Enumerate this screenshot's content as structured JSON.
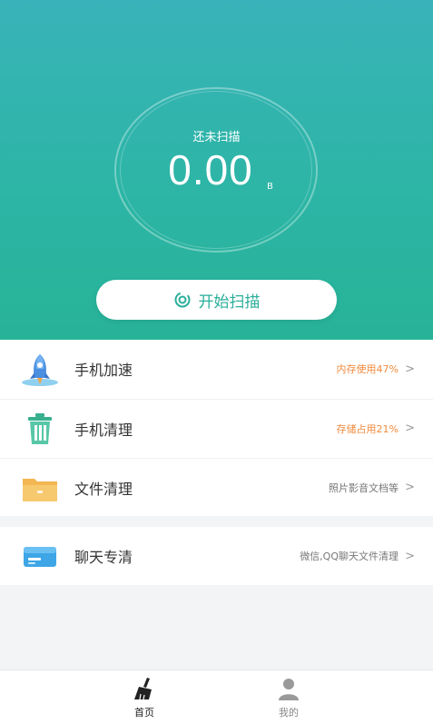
{
  "hero": {
    "status": "还未扫描",
    "value": "0.00",
    "unit": "B",
    "scan_button": "开始扫描"
  },
  "features": [
    {
      "title": "手机加速",
      "subtitle": "内存使用47%",
      "icon": "rocket-icon"
    },
    {
      "title": "手机清理",
      "subtitle": "存储占用21%",
      "icon": "trash-icon"
    },
    {
      "title": "文件清理",
      "subtitle": "照片影音文档等",
      "icon": "folder-icon"
    }
  ],
  "chat_clean": {
    "title": "聊天专清",
    "subtitle": "微信,QQ聊天文件清理",
    "icon": "chat-card-icon"
  },
  "tabs": [
    {
      "label": "首页",
      "icon": "broom-icon",
      "active": true
    },
    {
      "label": "我的",
      "icon": "user-icon",
      "active": false
    }
  ],
  "colors": {
    "accent": "#2bae9a",
    "warning": "#f08a3c",
    "hero_top": "#39b3b9",
    "hero_bottom": "#27b398"
  }
}
